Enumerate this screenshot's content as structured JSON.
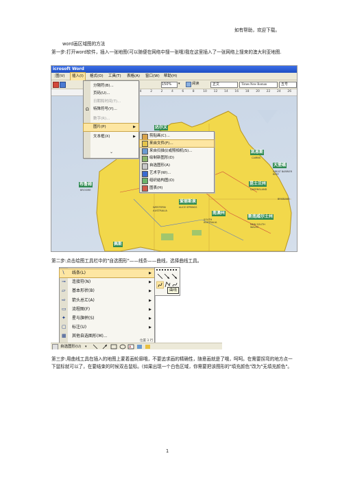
{
  "header": {
    "text": "如有帮助，欢迎下载。"
  },
  "doc": {
    "title": "word画区域图的方法",
    "step1": "第一步:打开word软件，插入一张地图(可以随便在网络中搜一张哦)我在这里插入了一张网络上搜来的澳大利亚地图.",
    "step2": "第二步:点击绘图工具栏中的\"自选图形\"——线条——曲线，选择曲线工具。",
    "step3": "第三步:用曲线工具在插入的地图上蒙着画轮廓哦，不要追求画的精确性，随意画就是了哦，呵呵。在需要拐弯的地方点一下鼠标就可以了，在要结束的时候双击鼠标。(如果出现一个白色区域，你需要把该图形的\"填充颜色\"改为\"无填充颜色\"。",
    "page_number": "1"
  },
  "screenshot1": {
    "title_bar": "icrosoft Word",
    "menubar": [
      "图(V)",
      "插入(I)",
      "格式(O)",
      "工具(T)",
      "表格(A)",
      "窗口(W)",
      "帮助(H)"
    ],
    "zoom": "150%",
    "style_box": "正文",
    "font_box": "Times New Roman",
    "size_box": "五号",
    "read_button": "阅读",
    "ruler_numbers": [
      "8",
      "6",
      "4",
      "2",
      "2",
      "4",
      "6",
      "8",
      "10",
      "12",
      "14",
      "16",
      "18",
      "20",
      "22",
      "24",
      "26"
    ],
    "insert_menu": [
      {
        "label": "分隔符(B)...",
        "arrow": false,
        "disabled": false
      },
      {
        "label": "页码(U)...",
        "arrow": false,
        "disabled": false
      },
      {
        "label": "日期和时间(T)...",
        "arrow": false,
        "disabled": true
      },
      {
        "label": "特殊符号(Y)...",
        "arrow": false,
        "disabled": false
      },
      {
        "label": "数字(R)...",
        "arrow": false,
        "disabled": true
      },
      {
        "label": "图片(P)",
        "arrow": true,
        "disabled": false
      },
      {
        "label": "文本框(X)",
        "arrow": true,
        "disabled": false
      }
    ],
    "picture_menu": [
      "剪贴画(C)...",
      "来自文件(F)...",
      "来自扫描仪或照相机(S)...",
      "绘制新图形(D)",
      "自选图形(A)",
      "艺术字(W)...",
      "组织结构图(O)",
      "图表(H)"
    ],
    "map_regions": [
      "达尔文",
      "凯恩斯",
      "大堡礁",
      "布鲁姆",
      "昆士兰州",
      "爱丽斯泉",
      "南澳州",
      "新南威尔士州",
      "佩斯"
    ],
    "map_small_labels": [
      "CAIRNS",
      "GREAT BARRIER REEF",
      "BROOME",
      "QUEENSLAND",
      "ALICE SPRINGS",
      "WESTERN AUSTRALIA",
      "SOUTH AUSTRALIA",
      "NEW SOUTH WALES",
      "BRISBANE"
    ]
  },
  "screenshot2": {
    "autoshape_menu": [
      {
        "label": "线条(L)",
        "selected": true
      },
      {
        "label": "连接符(N)",
        "selected": false
      },
      {
        "label": "基本形状(B)",
        "selected": false
      },
      {
        "label": "箭头总汇(A)",
        "selected": false
      },
      {
        "label": "流程图(F)",
        "selected": false
      },
      {
        "label": "星与旗帜(S)",
        "selected": false
      },
      {
        "label": "标注(U)",
        "selected": false
      },
      {
        "label": "其他自选图形(M)...",
        "selected": false
      }
    ],
    "tooltip": "曲线",
    "draw_toolbar_label": "自选图形(U)",
    "bottom_bar_fragment": "位置 3 行"
  },
  "colors": {
    "menu_bg": "#f7f6f0",
    "highlight": "#fde6a2",
    "title_bar": "#2a5bd7",
    "map_land": "#f2d84b",
    "region_green": "#2f8a52"
  }
}
